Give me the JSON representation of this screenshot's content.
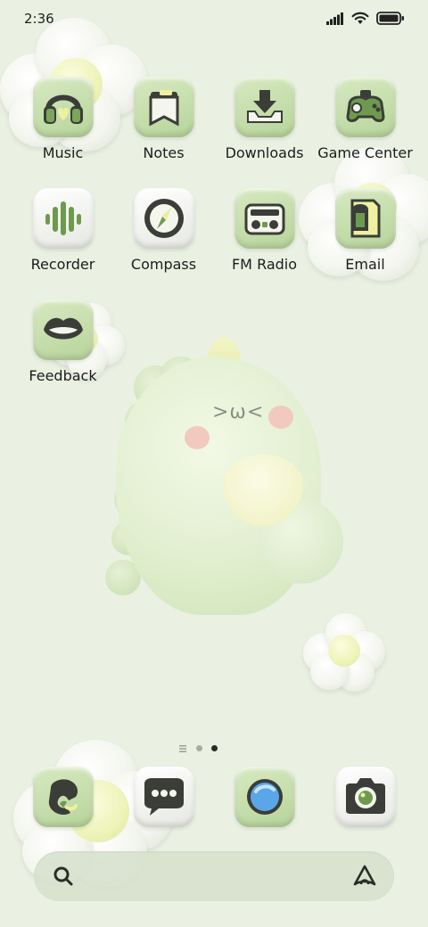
{
  "status_bar": {
    "time": "2:36",
    "icons": [
      "signal-icon",
      "wifi-icon",
      "battery-icon"
    ]
  },
  "apps": [
    {
      "label": "Music",
      "icon": "music-headphones-icon"
    },
    {
      "label": "Notes",
      "icon": "notes-icon"
    },
    {
      "label": "Downloads",
      "icon": "download-icon"
    },
    {
      "label": "Game Center",
      "icon": "gamepad-icon"
    },
    {
      "label": "Recorder",
      "icon": "recorder-icon"
    },
    {
      "label": "Compass",
      "icon": "compass-icon"
    },
    {
      "label": "FM Radio",
      "icon": "radio-icon"
    },
    {
      "label": "Email",
      "icon": "email-icon"
    },
    {
      "label": "Feedback",
      "icon": "lips-icon"
    }
  ],
  "page_indicator": {
    "pages": 3,
    "current": 2
  },
  "dock": [
    {
      "name": "phone",
      "icon": "phone-icon"
    },
    {
      "name": "messages",
      "icon": "message-icon"
    },
    {
      "name": "browser",
      "icon": "browser-icon"
    },
    {
      "name": "camera",
      "icon": "camera-icon"
    }
  ],
  "search_bar": {
    "icon": "search-icon",
    "assistant_icon": "assistant-icon"
  },
  "colors": {
    "background": "#eaf1e2",
    "icon_green": "#b7d49a",
    "icon_dark": "#3b3d38",
    "accent_yellow": "#eef0bd"
  }
}
